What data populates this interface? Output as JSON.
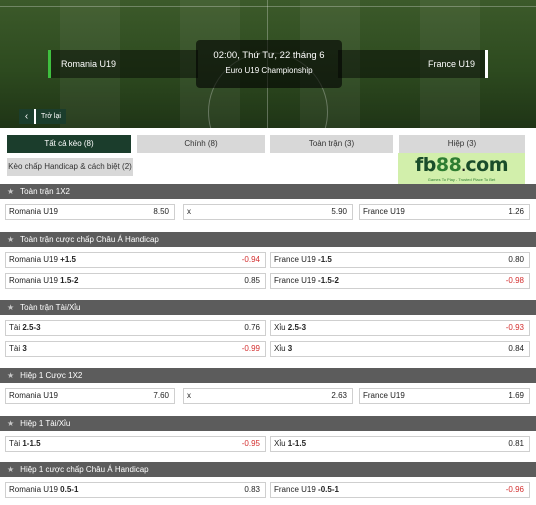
{
  "match": {
    "home": "Romania U19",
    "away": "France U19",
    "datetime": "02:00, Thứ Tư, 22 tháng 6",
    "league": "Euro U19 Championship"
  },
  "back_label": "Trở lại",
  "tabs": [
    "Tất cả kèo (8)",
    "Chính (8)",
    "Toàn trận (3)",
    "Hiệp (3)",
    "Kèo chấp Handicap & cách biệt (2)"
  ],
  "logo": {
    "fb": "fb",
    "n88": "88",
    "dot": ".",
    "com": "com",
    "tagline": "Games To Play - Trusted Place To Bet"
  },
  "colors": {
    "accent": "#1b3d2c",
    "negative_odds": "#d32f2f",
    "section_header": "#5c5c5c"
  },
  "sections": [
    {
      "title": "Toàn trận 1X2",
      "rows": [
        [
          {
            "label": "Romania U19",
            "line": "",
            "odds": "8.50"
          },
          {
            "label": "x",
            "line": "",
            "odds": "5.90"
          },
          {
            "label": "France U19",
            "line": "",
            "odds": "1.26"
          }
        ]
      ]
    },
    {
      "title": "Toàn trận cược chấp Châu Á Handicap",
      "rows": [
        [
          {
            "label": "Romania U19",
            "line": "+1.5",
            "odds": "-0.94"
          },
          {
            "label": "France U19",
            "line": "-1.5",
            "odds": "0.80"
          }
        ],
        [
          {
            "label": "Romania U19",
            "line": "1.5-2",
            "odds": "0.85"
          },
          {
            "label": "France U19",
            "line": "-1.5-2",
            "odds": "-0.98"
          }
        ]
      ]
    },
    {
      "title": "Toàn trận Tài/Xỉu",
      "rows": [
        [
          {
            "label": "Tài",
            "line": "2.5-3",
            "odds": "0.76"
          },
          {
            "label": "Xỉu",
            "line": "2.5-3",
            "odds": "-0.93"
          }
        ],
        [
          {
            "label": "Tài",
            "line": "3",
            "odds": "-0.99"
          },
          {
            "label": "Xỉu",
            "line": "3",
            "odds": "0.84"
          }
        ]
      ]
    },
    {
      "title": "Hiệp 1 Cược 1X2",
      "rows": [
        [
          {
            "label": "Romania U19",
            "line": "",
            "odds": "7.60"
          },
          {
            "label": "x",
            "line": "",
            "odds": "2.63"
          },
          {
            "label": "France U19",
            "line": "",
            "odds": "1.69"
          }
        ]
      ]
    },
    {
      "title": "Hiệp 1 Tài/Xỉu",
      "rows": [
        [
          {
            "label": "Tài",
            "line": "1-1.5",
            "odds": "-0.95"
          },
          {
            "label": "Xỉu",
            "line": "1-1.5",
            "odds": "0.81"
          }
        ]
      ]
    },
    {
      "title": "Hiệp 1 cược chấp Châu Á Handicap",
      "rows": [
        [
          {
            "label": "Romania U19",
            "line": "0.5-1",
            "odds": "0.83"
          },
          {
            "label": "France U19",
            "line": "-0.5-1",
            "odds": "-0.96"
          }
        ]
      ]
    }
  ]
}
